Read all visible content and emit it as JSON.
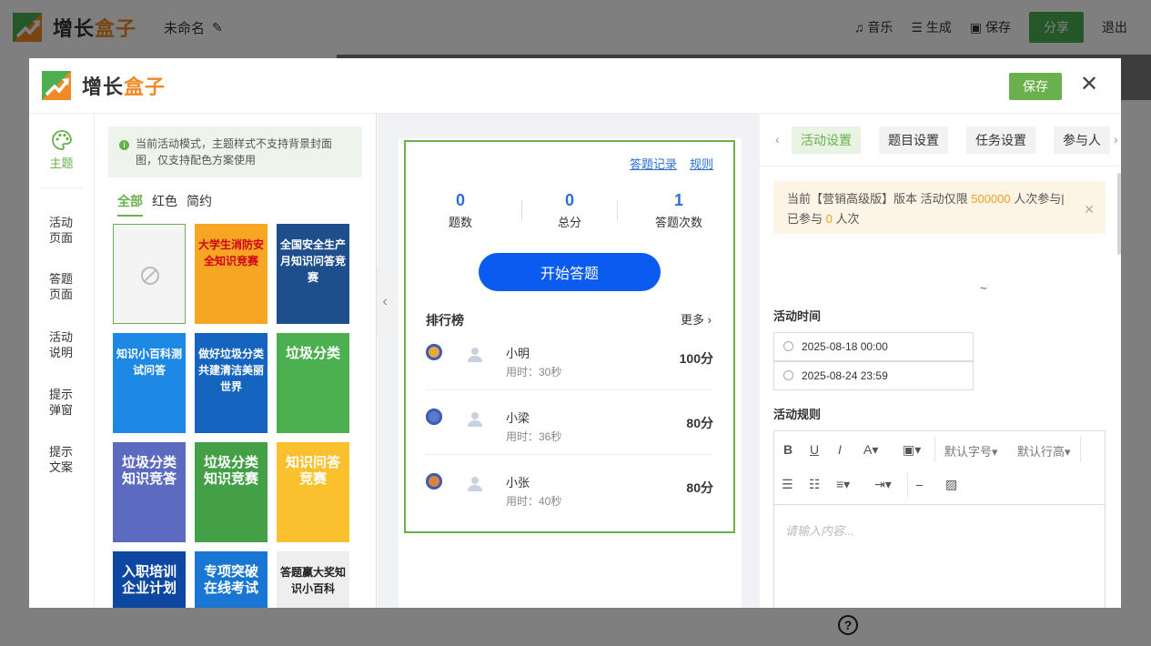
{
  "brand": {
    "name_part1": "增长",
    "name_part2": "盒子",
    "accent": "#f08a24",
    "green": "#6ab04c"
  },
  "background_app": {
    "doc_name": "未命名",
    "actions": {
      "music": "音乐",
      "generate": "生成",
      "save": "保存",
      "share": "分享",
      "exit": "退出"
    }
  },
  "modal": {
    "save_label": "保存",
    "close_icon": "close-icon",
    "nav": {
      "theme_label": "主题",
      "items": [
        "活动\n页面",
        "答题\n页面",
        "活动\n说明",
        "提示\n弹窗",
        "提示\n文案"
      ]
    },
    "themes_panel": {
      "notice": "当前活动模式，主题样式不支持背景封面图，仅支持配色方案使用",
      "filters": [
        "全部",
        "红色",
        "简约"
      ],
      "active_filter": 0,
      "cards": [
        {
          "title": "",
          "empty": true
        },
        {
          "title": "大学生消防安全知识竞赛",
          "bg": "#f6a623",
          "color": "#d0021b"
        },
        {
          "title": "全国安全生产月知识问答竞赛",
          "bg": "#1f4e8c",
          "color": "#fff"
        },
        {
          "title": "知识小百科测试问答",
          "bg": "#1e88e5",
          "color": "#fff"
        },
        {
          "title": "做好垃圾分类共建清洁美丽世界",
          "bg": "#1565c0",
          "color": "#fff"
        },
        {
          "title": "垃圾分类",
          "bg": "#4caf50",
          "color": "#fff"
        },
        {
          "title": "垃圾分类知识竞答",
          "bg": "#5c6bc0",
          "color": "#fff"
        },
        {
          "title": "垃圾分类知识竞赛",
          "bg": "#43a047",
          "color": "#fff"
        },
        {
          "title": "知识问答竞赛",
          "bg": "#fbc02d",
          "color": "#fff"
        },
        {
          "title": "入职培训企业计划",
          "bg": "#0d47a1",
          "color": "#fff"
        },
        {
          "title": "专项突破在线考试",
          "bg": "#1976d2",
          "color": "#fff"
        },
        {
          "title": "答题赢大奖知识小百科",
          "bg": "#eeeeee",
          "color": "#222"
        }
      ]
    },
    "preview": {
      "links": [
        "答题记录",
        "规则"
      ],
      "stats": [
        {
          "value": "0",
          "label": "题数"
        },
        {
          "value": "0",
          "label": "总分"
        },
        {
          "value": "1",
          "label": "答题次数"
        }
      ],
      "start_button": "开始答题",
      "ranking_title": "排行榜",
      "ranking_more": "更多",
      "ranking": [
        {
          "name": "小明",
          "time": "用时：30秒",
          "score": "100分",
          "medal": "#e8a93a"
        },
        {
          "name": "小梁",
          "time": "用时：36秒",
          "score": "80分",
          "medal": "#5d79c9"
        },
        {
          "name": "小张",
          "time": "用时：40秒",
          "score": "80分",
          "medal": "#d9833f"
        }
      ]
    },
    "settings": {
      "tabs": [
        "活动设置",
        "题目设置",
        "任务设置",
        "参与人"
      ],
      "active_tab": 0,
      "warning": {
        "part1": "当前【营销高级版】版本 活动仅限 ",
        "limit": "500000",
        "part2": " 人次参与| 已参与 ",
        "joined": "0",
        "part3": " 人次"
      },
      "time_label": "活动时间",
      "start_time": "2025-08-18 00:00",
      "end_time": "2025-08-24 23:59",
      "tilde": "~",
      "rules_label": "活动规则",
      "editor": {
        "font_size": "默认字号",
        "line_height": "默认行高",
        "placeholder": "请输入内容..."
      }
    }
  }
}
